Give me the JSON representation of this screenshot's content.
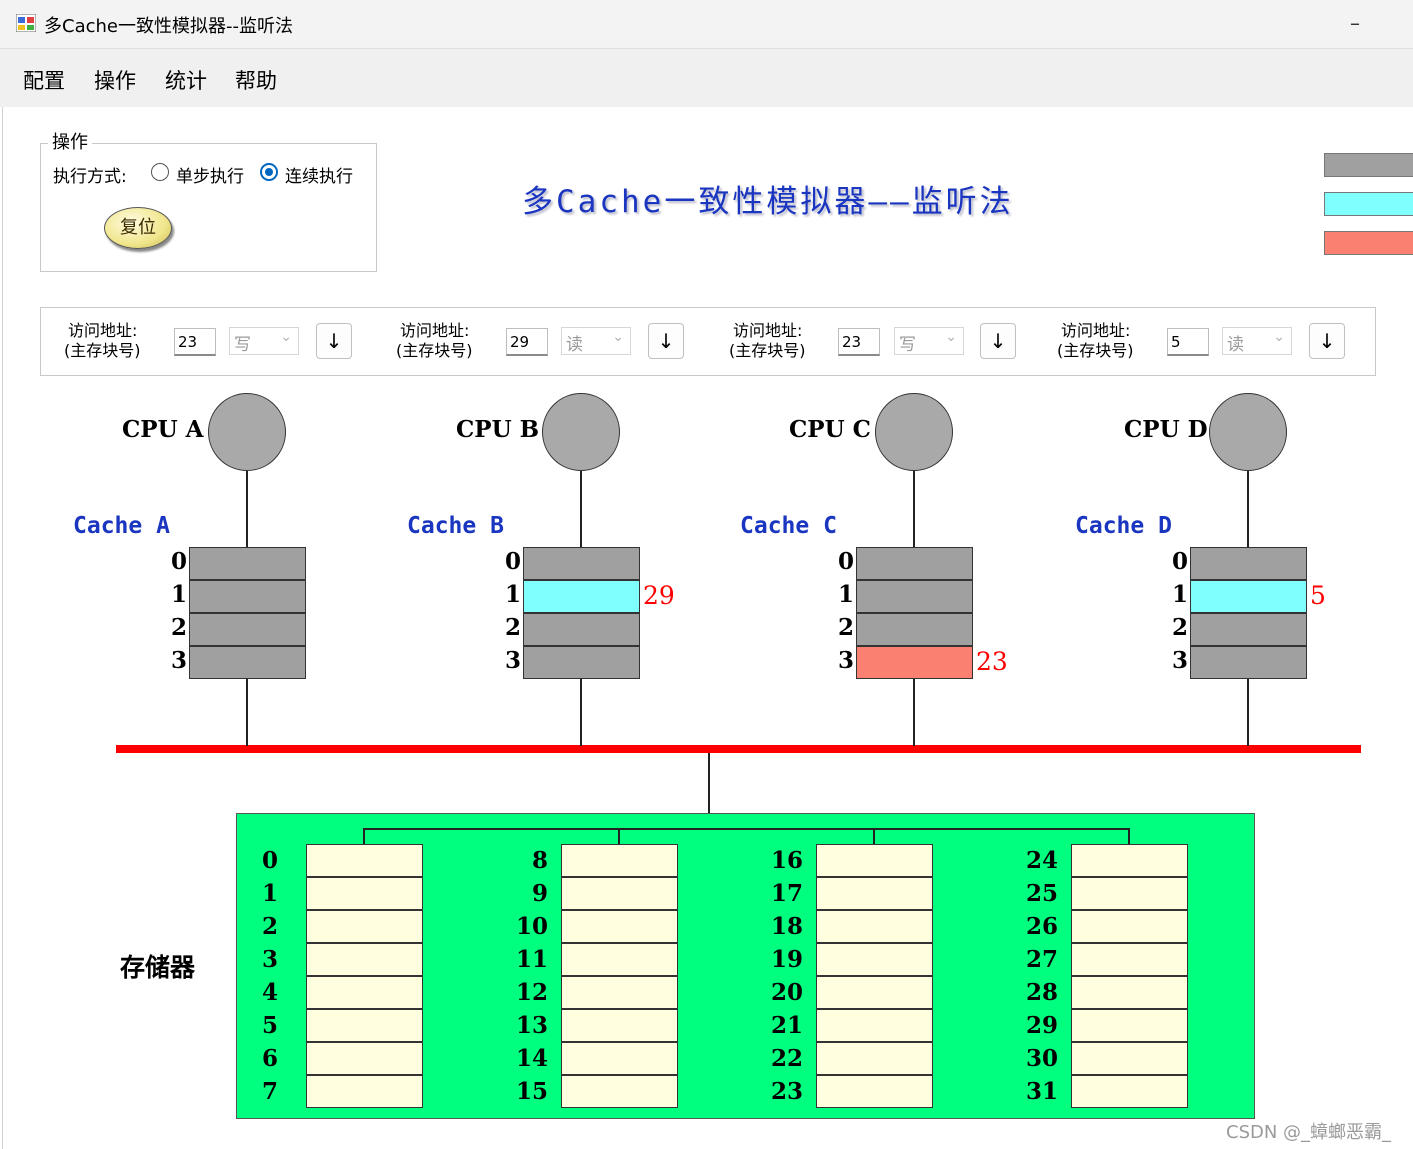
{
  "window": {
    "title": "多Cache一致性模拟器--监听法",
    "minimize_glyph": "–"
  },
  "menu": [
    "配置",
    "操作",
    "统计",
    "帮助"
  ],
  "operation": {
    "group_title": "操作",
    "exec_mode_label": "执行方式:",
    "modes": [
      {
        "label": "单步执行",
        "selected": false
      },
      {
        "label": "连续执行",
        "selected": true
      }
    ],
    "reset_label": "复位"
  },
  "main_title": "多Cache一致性模拟器——监听法",
  "state_legend_colors": [
    "#a0a0a0",
    "#80ffff",
    "#fa8072"
  ],
  "access_panel": {
    "label_line1": "访问地址:",
    "label_line2": "(主存块号)",
    "button_glyph": "↓",
    "processors": [
      {
        "address": "23",
        "op": "写"
      },
      {
        "address": "29",
        "op": "读"
      },
      {
        "address": "23",
        "op": "写"
      },
      {
        "address": "5",
        "op": "读"
      }
    ]
  },
  "cpus": [
    {
      "label": "CPU  A",
      "cache_label": "Cache  A",
      "lines": [
        {
          "index": "0",
          "state_color": "#a0a0a0",
          "block": ""
        },
        {
          "index": "1",
          "state_color": "#a0a0a0",
          "block": ""
        },
        {
          "index": "2",
          "state_color": "#a0a0a0",
          "block": ""
        },
        {
          "index": "3",
          "state_color": "#a0a0a0",
          "block": ""
        }
      ]
    },
    {
      "label": "CPU  B",
      "cache_label": "Cache  B",
      "lines": [
        {
          "index": "0",
          "state_color": "#a0a0a0",
          "block": ""
        },
        {
          "index": "1",
          "state_color": "#80ffff",
          "block": "29"
        },
        {
          "index": "2",
          "state_color": "#a0a0a0",
          "block": ""
        },
        {
          "index": "3",
          "state_color": "#a0a0a0",
          "block": ""
        }
      ]
    },
    {
      "label": "CPU  C",
      "cache_label": "Cache  C",
      "lines": [
        {
          "index": "0",
          "state_color": "#a0a0a0",
          "block": ""
        },
        {
          "index": "1",
          "state_color": "#a0a0a0",
          "block": ""
        },
        {
          "index": "2",
          "state_color": "#a0a0a0",
          "block": ""
        },
        {
          "index": "3",
          "state_color": "#fa8072",
          "block": "23"
        }
      ]
    },
    {
      "label": "CPU  D",
      "cache_label": "Cache  D",
      "lines": [
        {
          "index": "0",
          "state_color": "#a0a0a0",
          "block": ""
        },
        {
          "index": "1",
          "state_color": "#80ffff",
          "block": "5"
        },
        {
          "index": "2",
          "state_color": "#a0a0a0",
          "block": ""
        },
        {
          "index": "3",
          "state_color": "#a0a0a0",
          "block": ""
        }
      ]
    }
  ],
  "bus_color": "#ff0000",
  "memory": {
    "label": "存储器",
    "background": "#00ff7f",
    "cell_color": "#ffffe0",
    "banks": [
      [
        "0",
        "1",
        "2",
        "3",
        "4",
        "5",
        "6",
        "7"
      ],
      [
        "8",
        "9",
        "10",
        "11",
        "12",
        "13",
        "14",
        "15"
      ],
      [
        "16",
        "17",
        "18",
        "19",
        "20",
        "21",
        "22",
        "23"
      ],
      [
        "24",
        "25",
        "26",
        "27",
        "28",
        "29",
        "30",
        "31"
      ]
    ]
  },
  "watermark": "CSDN @_蟑螂恶霸_"
}
